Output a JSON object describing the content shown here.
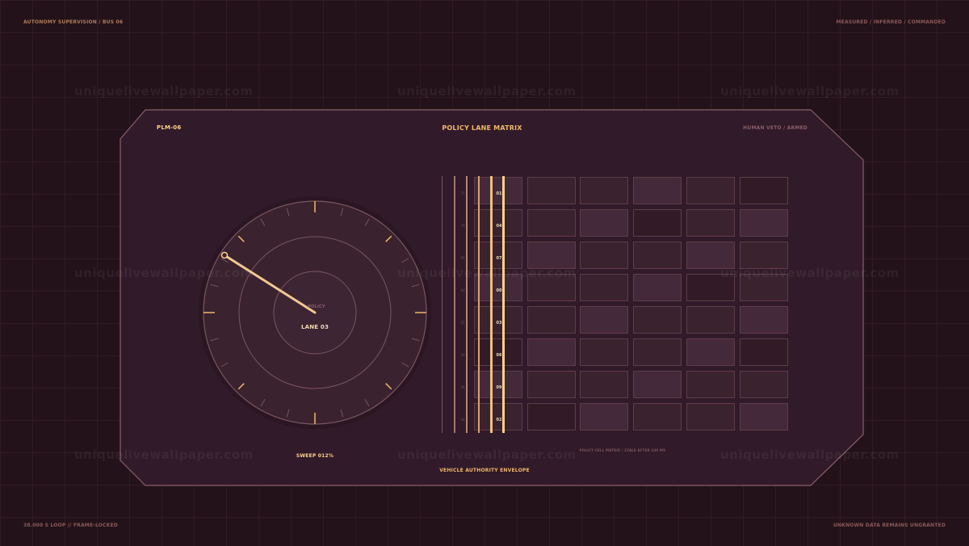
{
  "header": {
    "left": "AUTONOMY SUPERVISION / BUS 06",
    "right": "MEASURED  /  INFERRED  /  COMMANDED"
  },
  "footer": {
    "left": "38.000 S LOOP  //  FRAME-LOCKED",
    "right": "UNKNOWN DATA REMAINS UNGRANTED"
  },
  "watermark": "uniquelivewallpaper.com",
  "panel": {
    "id": "PLM-06",
    "title": "POLICY LANE MATRIX",
    "status": "HUMAN VETO / ARMED",
    "footer_title": "VEHICLE AUTHORITY ENVELOPE",
    "matrix_caption": "POLICY CELL MATRIX / STALE AFTER 240 MS"
  },
  "dial": {
    "policy_label": "POLICY",
    "lane_label": "LANE 03",
    "sweep_label": "SWEEP 012%"
  },
  "matrix": {
    "row_labels": [
      "01",
      "04",
      "07",
      "00",
      "03",
      "06",
      "09",
      "02"
    ],
    "tick_labels": [
      "75",
      "70",
      "65",
      "60",
      "55",
      "50",
      "45",
      "40"
    ]
  },
  "colors": {
    "accent": "#f0b868",
    "bright": "#ffd28a",
    "panel_bg": "#311a29",
    "panel_border": "#8a5f6a",
    "outer_bg": "#231219"
  }
}
